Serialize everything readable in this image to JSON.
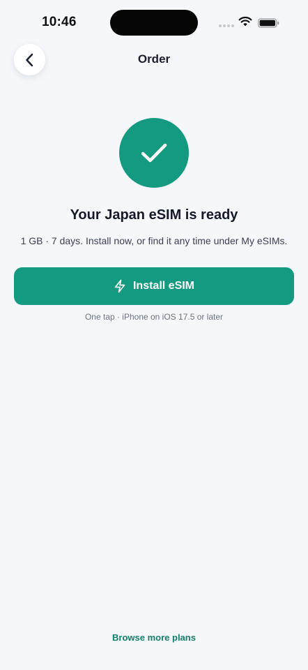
{
  "status_bar": {
    "time": "10:46"
  },
  "nav": {
    "title": "Order",
    "back_icon": "chevron-left-icon"
  },
  "confirmation": {
    "icon": "checkmark-icon",
    "headline": "Your Japan eSIM is ready",
    "subtext": "1 GB · 7 days. Install now, or find it any time under My eSIMs."
  },
  "install": {
    "label": "Install eSIM",
    "icon": "lightning-icon",
    "note": "One tap · iPhone on iOS 17.5 or later"
  },
  "footer": {
    "browse_label": "Browse more plans"
  },
  "colors": {
    "accent": "#139a80",
    "link": "#12806b",
    "background": "#f5f7fb"
  }
}
